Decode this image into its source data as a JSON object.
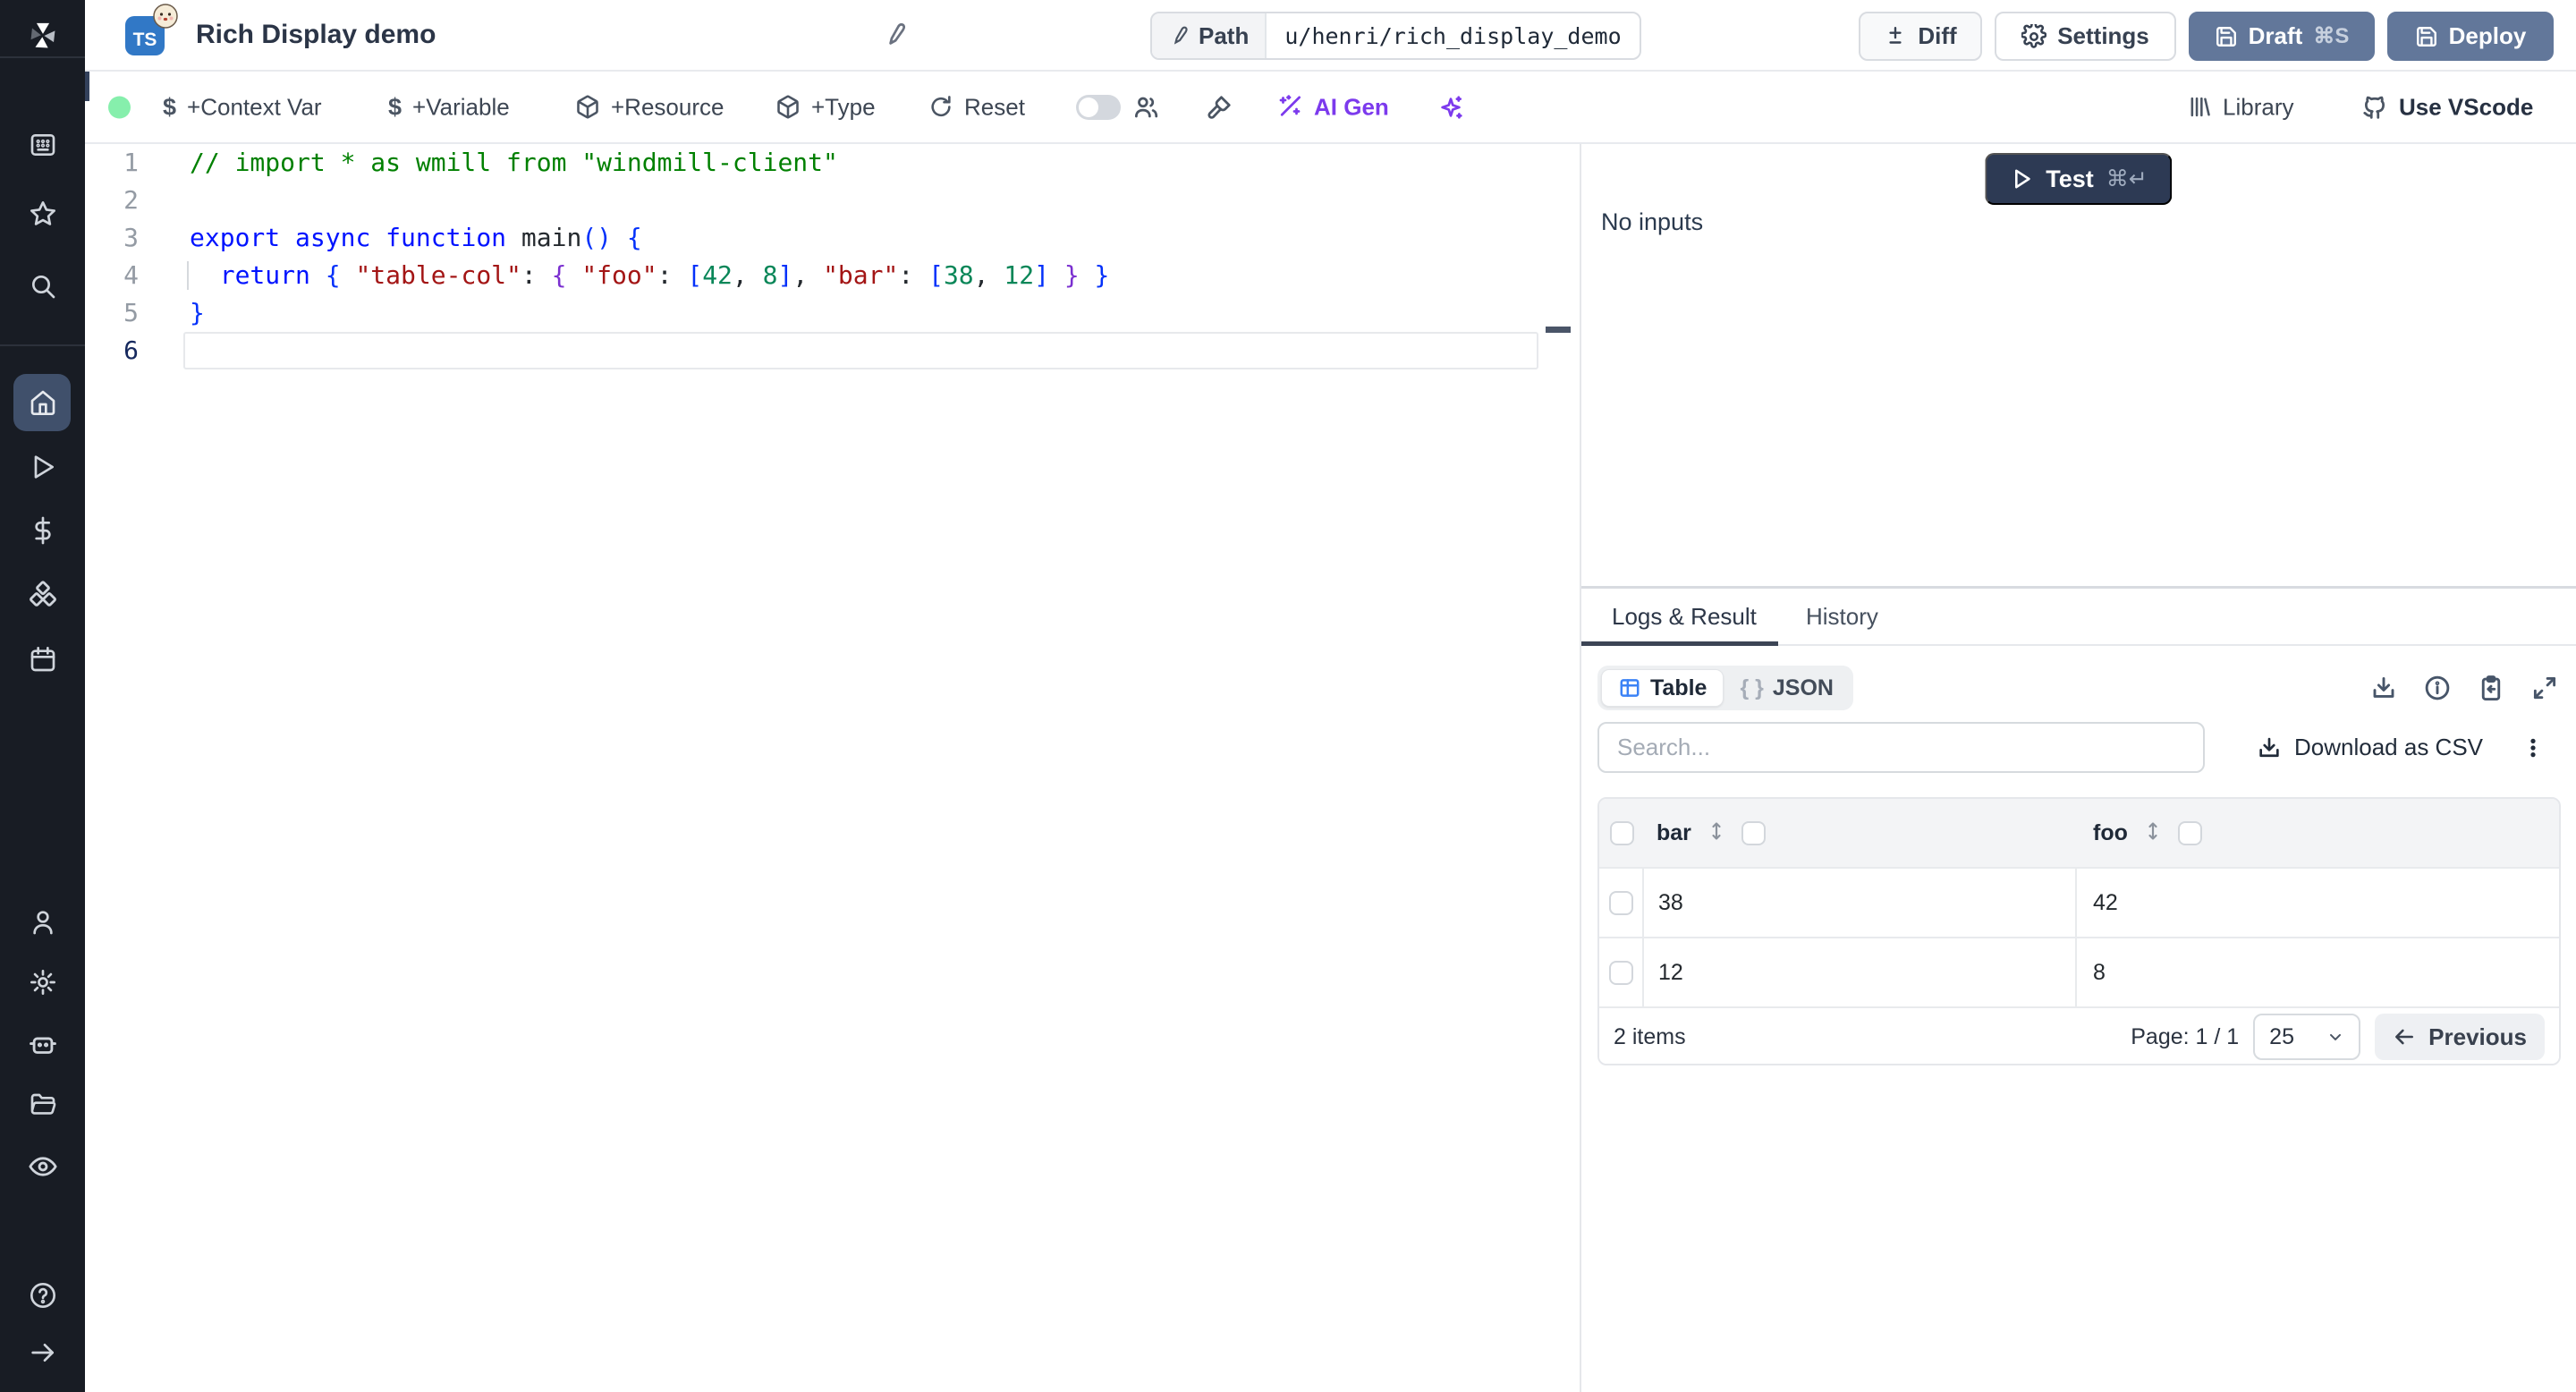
{
  "header": {
    "lang_badge": "TS",
    "title": "Rich Display demo",
    "path_label": "Path",
    "path_value": "u/henri/rich_display_demo",
    "diff_label": "Diff",
    "settings_label": "Settings",
    "draft_label": "Draft",
    "draft_shortcut": "⌘S",
    "deploy_label": "Deploy"
  },
  "toolbar": {
    "context_var": "+Context Var",
    "variable": "+Variable",
    "resource": "+Resource",
    "type": "+Type",
    "reset": "Reset",
    "ai_gen": "AI Gen",
    "library": "Library",
    "use_vscode": "Use VScode"
  },
  "editor": {
    "lines": [
      {
        "num": "1",
        "tokens": [
          {
            "c": "comment",
            "t": "// import * as wmill from \"windmill-client\""
          }
        ]
      },
      {
        "num": "2",
        "tokens": []
      },
      {
        "num": "3",
        "tokens": [
          {
            "c": "kw",
            "t": "export"
          },
          {
            "c": "plain",
            "t": " "
          },
          {
            "c": "kw",
            "t": "async"
          },
          {
            "c": "plain",
            "t": " "
          },
          {
            "c": "kw",
            "t": "function"
          },
          {
            "c": "plain",
            "t": " "
          },
          {
            "c": "fn",
            "t": "main"
          },
          {
            "c": "brace",
            "t": "()"
          },
          {
            "c": "plain",
            "t": " "
          },
          {
            "c": "brace",
            "t": "{"
          }
        ]
      },
      {
        "num": "4",
        "guide": true,
        "tokens": [
          {
            "c": "plain",
            "t": "  "
          },
          {
            "c": "kw",
            "t": "return"
          },
          {
            "c": "plain",
            "t": " "
          },
          {
            "c": "brace",
            "t": "{ "
          },
          {
            "c": "str",
            "t": "\"table-col\""
          },
          {
            "c": "plain",
            "t": ": "
          },
          {
            "c": "brace2",
            "t": "{ "
          },
          {
            "c": "str",
            "t": "\"foo\""
          },
          {
            "c": "plain",
            "t": ": "
          },
          {
            "c": "brace",
            "t": "["
          },
          {
            "c": "num",
            "t": "42"
          },
          {
            "c": "plain",
            "t": ", "
          },
          {
            "c": "num",
            "t": "8"
          },
          {
            "c": "brace",
            "t": "]"
          },
          {
            "c": "plain",
            "t": ", "
          },
          {
            "c": "str",
            "t": "\"bar\""
          },
          {
            "c": "plain",
            "t": ": "
          },
          {
            "c": "brace",
            "t": "["
          },
          {
            "c": "num",
            "t": "38"
          },
          {
            "c": "plain",
            "t": ", "
          },
          {
            "c": "num",
            "t": "12"
          },
          {
            "c": "brace",
            "t": "]"
          },
          {
            "c": "plain",
            "t": " "
          },
          {
            "c": "brace2",
            "t": "}"
          },
          {
            "c": "plain",
            "t": " "
          },
          {
            "c": "brace",
            "t": "}"
          }
        ]
      },
      {
        "num": "5",
        "tokens": [
          {
            "c": "brace",
            "t": "}"
          }
        ]
      },
      {
        "num": "6",
        "active": true,
        "tokens": []
      }
    ]
  },
  "run_panel": {
    "test_label": "Test",
    "test_shortcut": "⌘↵",
    "no_inputs": "No inputs"
  },
  "result_panel": {
    "tab_logs": "Logs & Result",
    "tab_history": "History",
    "view_table": "Table",
    "view_json": "JSON",
    "json_braces": "{ }",
    "search_placeholder": "Search...",
    "download_csv": "Download as CSV",
    "items_count": "2 items",
    "page_info": "Page: 1 / 1",
    "page_size": "25",
    "previous_label": "Previous"
  },
  "result_table": {
    "columns": [
      "bar",
      "foo"
    ],
    "rows": [
      [
        "38",
        "42"
      ],
      [
        "12",
        "8"
      ]
    ]
  },
  "colors": {
    "sidebar_bg": "#181c24",
    "sidebar_active": "#40506b",
    "ts_badge": "#3178c6",
    "slate_button": "#62779a",
    "test_button": "#2d3a54",
    "ai_violet": "#7c3aed",
    "status_green": "#86efac",
    "table_icon_blue": "#3b82f6",
    "code_comment": "#008000",
    "code_keyword": "#0013ff",
    "code_string": "#a31515",
    "code_number": "#098658"
  }
}
